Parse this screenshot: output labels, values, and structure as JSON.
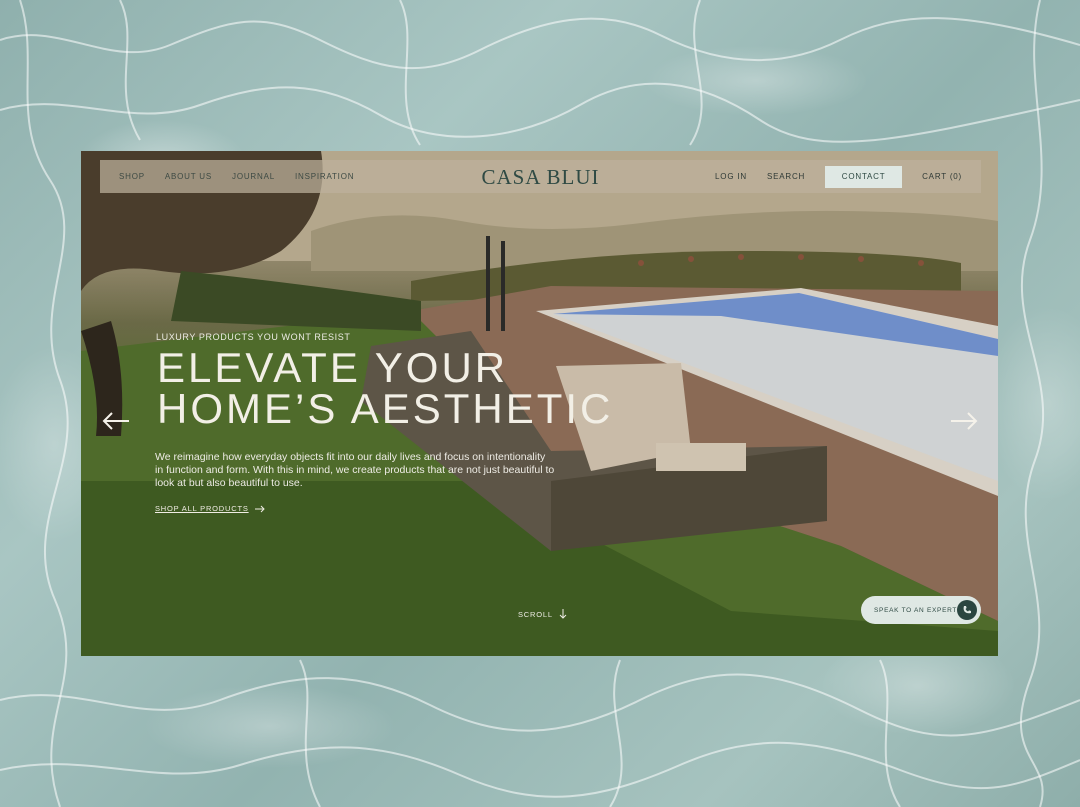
{
  "nav": {
    "left_links": [
      "SHOP",
      "ABOUT US",
      "JOURNAL",
      "INSPIRATION"
    ],
    "logo": "CASA BLUI",
    "login": "LOG IN",
    "search": "SEARCH",
    "contact": "CONTACT",
    "cart": "CART (0)"
  },
  "hero": {
    "eyebrow": "LUXURY PRODUCTS YOU WONT RESIST",
    "headline_line1": "ELEVATE YOUR",
    "headline_line2": "HOME’S AESTHETIC",
    "body": "We reimagine how everyday objects fit into our daily lives and focus on intentionality in function and form. With this in mind, we create products that are not just beautiful to look at but also beautiful to use.",
    "cta": "SHOP ALL PRODUCTS",
    "scroll": "SCROLL"
  },
  "expert_button": {
    "label": "SPEAK TO AN EXPERT"
  },
  "icons": [
    "arrow-left-icon",
    "arrow-right-icon",
    "arrow-down-icon",
    "phone-icon",
    "arrow-right-small-icon"
  ],
  "colors": {
    "accent": "#2f4a44",
    "button_bg": "#dfe8e4",
    "pool_water": "#8fb0ad"
  }
}
